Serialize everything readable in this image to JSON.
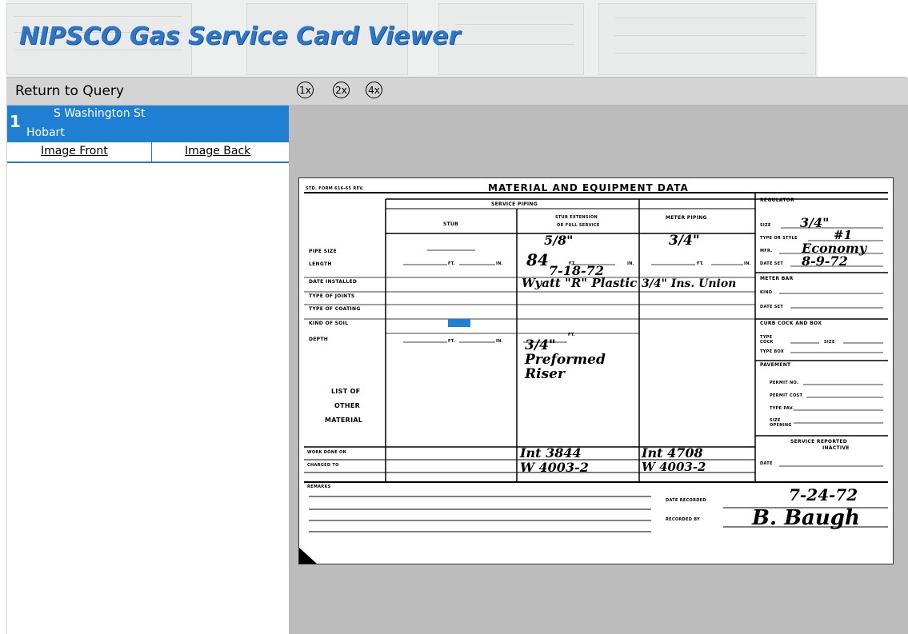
{
  "app": {
    "title": "NIPSCO Gas Service Card Viewer"
  },
  "toolbar": {
    "return_label": "Return to Query",
    "zoom_levels": [
      "1x",
      "2x",
      "4x"
    ]
  },
  "results": [
    {
      "index": "1",
      "street": "S Washington St",
      "city": "Hobart"
    }
  ],
  "image_tabs": {
    "front": "Image Front",
    "back": "Image Back"
  },
  "card": {
    "form_number": "STD. FORM 616-65 REV.",
    "title": "MATERIAL AND EQUIPMENT DATA",
    "service_piping": "SERVICE PIPING",
    "stub": "STUB",
    "stub_extension": "STUB EXTENSION",
    "on_full_service": "OR FULL SERVICE",
    "meter_piping": "METER PIPING",
    "rows": [
      "PIPE SIZE",
      "LENGTH",
      "DATE INSTALLED",
      "TYPE OF JOINTS",
      "TYPE OF COATING",
      "KIND OF SOIL",
      "DEPTH"
    ],
    "list_other_1": "LIST OF",
    "list_other_2": "OTHER",
    "list_other_3": "MATERIAL",
    "work_done_on": "WORK DONE ON",
    "charged_to": "CHARGED TO",
    "remarks": "REMARKS",
    "ft": "FT.",
    "in": "IN.",
    "regulator": "REGULATOR",
    "size": "SIZE",
    "type_or_style": "TYPE OR STYLE",
    "mfr": "MFR.",
    "date_set": "DATE SET",
    "meter_bar": "METER BAR",
    "kind": "KIND",
    "curb_cock": "CURB COCK AND BOX",
    "type_cock": "TYPE COCK",
    "type_box": "TYPE BOX",
    "pavement": "PAVEMENT",
    "permit_no": "PERMIT NO.",
    "permit_cost": "PERMIT COST",
    "type_pav": "TYPE PAV.",
    "size_opening": "SIZE OPENING",
    "service_reported": "SERVICE REPORTED",
    "inactive": "INACTIVE",
    "date": "DATE",
    "date_recorded": "DATE RECORDED",
    "recorded_by": "RECORDED BY",
    "hw": {
      "ext_size": "5/8\"",
      "ext_length": "84",
      "ext_date": "7-18-72",
      "ext_joints": "Wyatt \"R\" Plastic",
      "ext_other": "3/4\" Preformed Riser",
      "meter_size": "3/4\"",
      "meter_joints": "3/4\" Ins. Union",
      "reg_size": "3/4\"",
      "reg_type": "#1",
      "reg_mfr": "Economy",
      "reg_date": "8-9-72",
      "work_ext": "Int 3844",
      "charged_ext": "W 4003-2",
      "work_meter": "Int 4708",
      "charged_meter": "W 4003-2",
      "date_recorded": "7-24-72",
      "recorded_by": "B. Baugh"
    }
  }
}
